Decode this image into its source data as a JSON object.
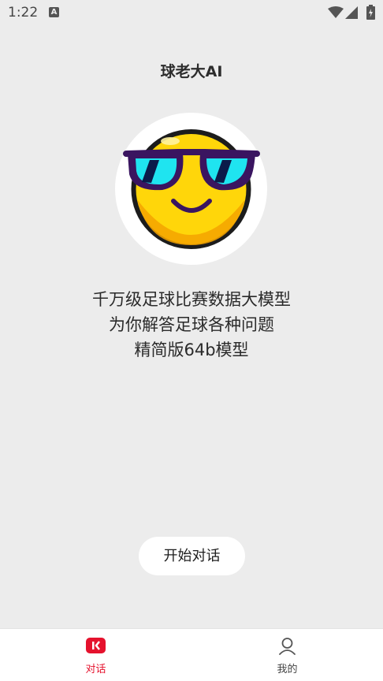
{
  "status_bar": {
    "time": "1:22",
    "notification_icon": "a-icon",
    "wifi_icon": "wifi-icon",
    "signal_icon": "signal-icon",
    "battery_icon": "battery-charging-icon"
  },
  "app": {
    "title": "球老大AI"
  },
  "avatar": {
    "icon": "sunglasses-emoji-icon"
  },
  "description": {
    "lines": [
      "千万级足球比赛数据大模型",
      "为你解答足球各种问题",
      "精简版64b模型"
    ]
  },
  "start_button": {
    "label": "开始对话"
  },
  "bottom_nav": {
    "items": [
      {
        "label": "对话",
        "icon": "chat-icon",
        "active": true
      },
      {
        "label": "我的",
        "icon": "user-icon",
        "active": false
      }
    ]
  },
  "colors": {
    "background": "#ececec",
    "accent": "#e5122d",
    "emoji_yellow": "#ffd60a",
    "lens": "#1fe4f0",
    "frame": "#3a1560"
  }
}
